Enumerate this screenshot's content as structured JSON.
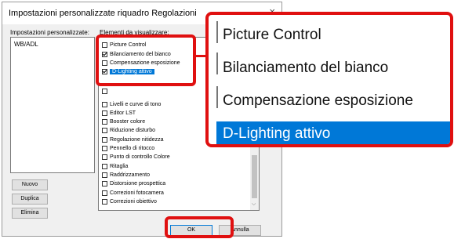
{
  "dialog": {
    "title": "Impostazioni personalizzate riquadro Regolazioni",
    "close_glyph": "×",
    "custom_settings_label": "Impostazioni personalizzate:",
    "custom_settings_items": [
      "WB/ADL"
    ],
    "elements_label": "Elementi da visualizzare:",
    "elements": [
      {
        "label": "Picture Control",
        "checked": false,
        "selected": false
      },
      {
        "label": "Bilanciamento del bianco",
        "checked": true,
        "selected": false
      },
      {
        "label": "Compensazione esposizione",
        "checked": false,
        "selected": false
      },
      {
        "label": "D-Lighting attivo",
        "checked": true,
        "selected": true
      },
      {
        "label": "",
        "checked": false,
        "selected": false
      },
      {
        "label": "Livelli e curve di tono",
        "checked": false,
        "selected": false
      },
      {
        "label": "Editor LST",
        "checked": false,
        "selected": false
      },
      {
        "label": "Booster colore",
        "checked": false,
        "selected": false
      },
      {
        "label": "Riduzione disturbo",
        "checked": false,
        "selected": false
      },
      {
        "label": "Regolazione nitidezza",
        "checked": false,
        "selected": false
      },
      {
        "label": "Pennello di ritocco",
        "checked": false,
        "selected": false
      },
      {
        "label": "Punto di controllo Colore",
        "checked": false,
        "selected": false
      },
      {
        "label": "Ritaglia",
        "checked": false,
        "selected": false
      },
      {
        "label": "Raddrizzamento",
        "checked": false,
        "selected": false
      },
      {
        "label": "Distorsione prospettica",
        "checked": false,
        "selected": false
      },
      {
        "label": "Correzioni fotocamera",
        "checked": false,
        "selected": false
      },
      {
        "label": "Correzioni obiettivo",
        "checked": false,
        "selected": false
      }
    ],
    "buttons": {
      "new": "Nuovo",
      "duplicate": "Duplica",
      "delete": "Elimina",
      "ok": "OK",
      "cancel": "Annulla"
    }
  },
  "zoom": {
    "rows": [
      {
        "label": "Picture Control",
        "selected": false
      },
      {
        "label": "Bilanciamento del bianco",
        "selected": false
      },
      {
        "label": "Compensazione esposizione",
        "selected": false
      },
      {
        "label": "D-Lighting attivo",
        "selected": true
      }
    ]
  },
  "colors": {
    "highlight": "#e01010",
    "selection": "#0078d7"
  }
}
